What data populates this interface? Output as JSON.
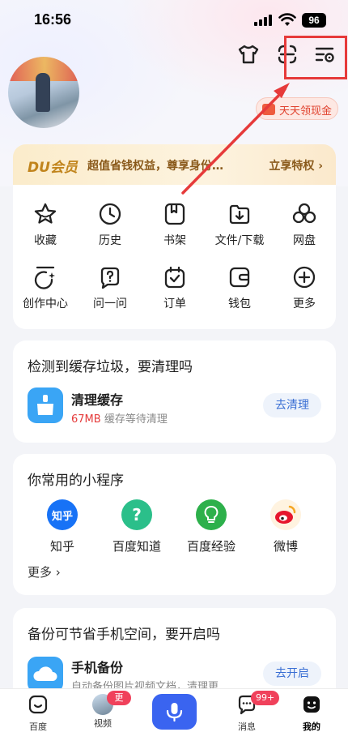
{
  "status_bar": {
    "time": "16:56",
    "battery": "96"
  },
  "header": {
    "cash_pill_label": "天天领现金"
  },
  "vip": {
    "logo": "DU会员",
    "description": "超值省钱权益，尊享身份…",
    "cta": "立享特权 ›"
  },
  "tools": {
    "row1": [
      {
        "label": "收藏",
        "icon": "star-icon"
      },
      {
        "label": "历史",
        "icon": "clock-icon"
      },
      {
        "label": "书架",
        "icon": "bookshelf-icon"
      },
      {
        "label": "文件/下载",
        "icon": "download-icon"
      },
      {
        "label": "网盘",
        "icon": "cloud-disk-icon"
      }
    ],
    "row2": [
      {
        "label": "创作中心",
        "icon": "creation-icon"
      },
      {
        "label": "问一问",
        "icon": "question-icon"
      },
      {
        "label": "订单",
        "icon": "order-icon"
      },
      {
        "label": "钱包",
        "icon": "wallet-icon"
      },
      {
        "label": "更多",
        "icon": "plus-circle-icon"
      }
    ]
  },
  "cache": {
    "title": "检测到缓存垃圾，要清理吗",
    "name": "清理缓存",
    "size": "67MB",
    "subtitle": "缓存等待清理",
    "button": "去清理"
  },
  "mini_programs": {
    "title": "你常用的小程序",
    "items": [
      {
        "label": "知乎",
        "icon_text": "知乎",
        "color": "#1772f6"
      },
      {
        "label": "百度知道",
        "icon_text": "?",
        "color": "#2bbf8a"
      },
      {
        "label": "百度经验",
        "icon_text": "",
        "color": "#2db04b"
      },
      {
        "label": "微博",
        "icon_text": "",
        "color": "#f5a623"
      }
    ],
    "more": "更多 ›"
  },
  "backup": {
    "title": "备份可节省手机空间，要开启吗",
    "name": "手机备份",
    "subtitle": "自动备份图片视频文档，清理更…",
    "button": "去开启"
  },
  "tabbar": {
    "items": [
      {
        "label": "百度"
      },
      {
        "label": "视频",
        "badge": "更新"
      },
      {
        "label": ""
      },
      {
        "label": "消息",
        "badge": "99+"
      },
      {
        "label": "我的"
      }
    ]
  },
  "colors": {
    "accent": "#3a64f0",
    "highlight": "#e63a3a",
    "vip_text": "#8a5a1b"
  }
}
